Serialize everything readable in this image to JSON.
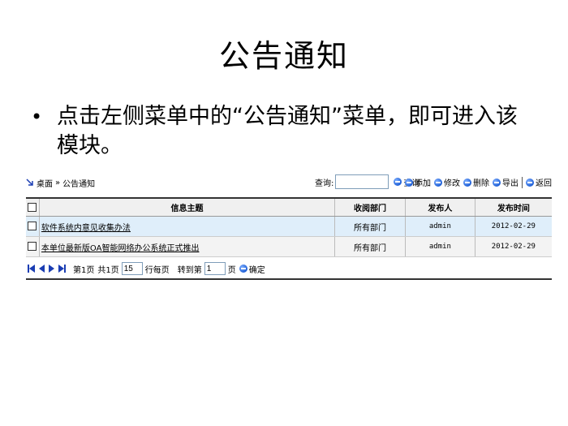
{
  "slide": {
    "title": "公告通知",
    "bullet": "点击左侧菜单中的“公告通知”菜单，即可进入该模块。"
  },
  "breadcrumb": {
    "home": "桌面",
    "separator": "»",
    "current": "公告通知"
  },
  "search": {
    "label": "查询:",
    "value": "",
    "button": "查询"
  },
  "actions": {
    "add": "添加",
    "edit": "修改",
    "delete": "删除",
    "export": "导出",
    "back": "返回"
  },
  "table": {
    "headers": [
      "信息主题",
      "收阅部门",
      "发布人",
      "发布时间"
    ],
    "rows": [
      {
        "subject": "软件系统内意见收集办法",
        "dept": "所有部门",
        "publisher": "admin",
        "date": "2012-02-29"
      },
      {
        "subject": "本单位最新版OA智能网络办公系统正式推出",
        "dept": "所有部门",
        "publisher": "admin",
        "date": "2012-02-29"
      }
    ]
  },
  "pager": {
    "page_info": "第1页",
    "total_info": "共1页",
    "per_page": "15",
    "per_page_label": "行每页",
    "goto_label": "转到第",
    "goto_value": "1",
    "page_unit": "页",
    "confirm": "确定"
  },
  "icons": {
    "nav": [
      "first-icon",
      "prev-icon",
      "next-icon",
      "last-icon"
    ],
    "action": "blue-circle-icon",
    "breadcrumb": "diagonal-arrow-icon"
  },
  "colors": {
    "row_highlight": "#dfeefa",
    "row_alt": "#f3f3f3",
    "accent": "#1f5fd6"
  }
}
